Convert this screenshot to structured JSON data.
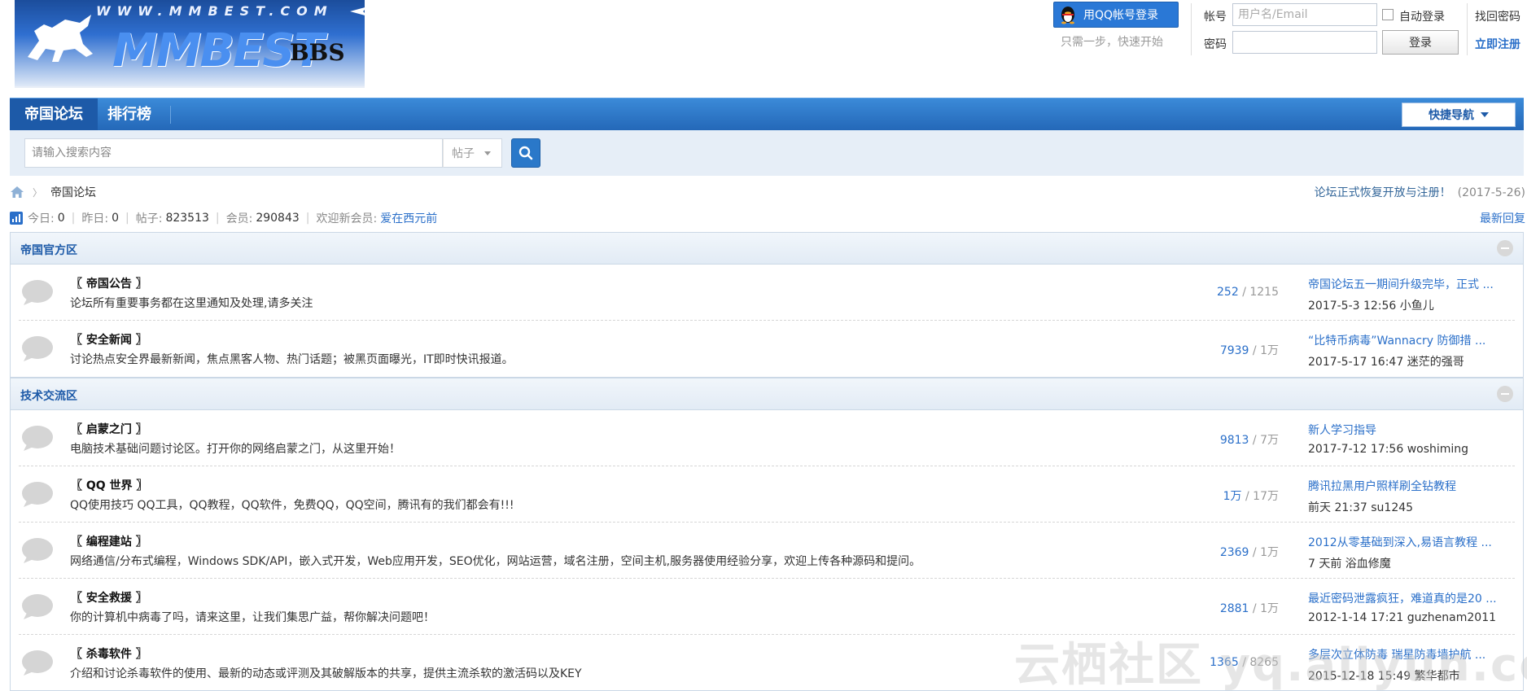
{
  "header": {
    "logo_url_text": "WWW.MMBEST.COM",
    "logo_brand": "MMBEST",
    "logo_bbs": "BBS",
    "qq_login_label": "用QQ帐号登录",
    "qq_note": "只需一步，快速开始",
    "account_label": "帐号",
    "account_placeholder": "用户名/Email",
    "password_label": "密码",
    "auto_login_label": "自动登录",
    "login_button": "登录",
    "find_password": "找回密码",
    "register": "立即注册"
  },
  "nav": {
    "items": [
      {
        "label": "帝国论坛",
        "active": true
      },
      {
        "label": "排行榜",
        "active": false
      }
    ],
    "quick_nav": "快捷导航"
  },
  "search": {
    "placeholder": "请输入搜索内容",
    "type": "帖子"
  },
  "breadcrumb": {
    "current": "帝国论坛"
  },
  "notice": {
    "text": "论坛正式恢复开放与注册！",
    "date": "(2017-5-26)"
  },
  "stats": {
    "today_label": "今日:",
    "today": "0",
    "yesterday_label": "昨日:",
    "yesterday": "0",
    "posts_label": "帖子:",
    "posts": "823513",
    "members_label": "会员:",
    "members": "290843",
    "welcome_label": "欢迎新会员:",
    "new_member": "爱在西元前",
    "latest_reply": "最新回复"
  },
  "sections": [
    {
      "title": "帝国官方区",
      "forums": [
        {
          "name": "〖 帝国公告 〗",
          "desc": "论坛所有重要事务都在这里通知及处理,请多关注",
          "threads": "252",
          "posts": "1215",
          "last_title": "帝国论坛五一期间升级完毕，正式 ...",
          "last_meta": "2017-5-3 12:56 小鱼儿"
        },
        {
          "name": "〖 安全新闻 〗",
          "desc": "讨论热点安全界最新新闻，焦点黑客人物、热门话题；被黑页面曝光，IT即时快讯报道。",
          "threads": "7939",
          "posts": "1万",
          "last_title": "“比特币病毒”Wannacry 防御措 ...",
          "last_meta": "2017-5-17 16:47 迷茫的强哥"
        }
      ]
    },
    {
      "title": "技术交流区",
      "forums": [
        {
          "name": "〖 启蒙之门 〗",
          "desc": "电脑技术基础问题讨论区。打开你的网络启蒙之门，从这里开始！",
          "threads": "9813",
          "posts": "7万",
          "last_title": "新人学习指导",
          "last_meta": "2017-7-12 17:56 woshiming"
        },
        {
          "name": "〖 QQ 世界 〗",
          "desc": "QQ使用技巧 QQ工具，QQ教程，QQ软件，免费QQ，QQ空间，腾讯有的我们都会有!!!",
          "threads": "1万",
          "posts": "17万",
          "last_title": "腾讯拉黑用户照样刷全钻教程",
          "last_meta": "前天 21:37 su1245"
        },
        {
          "name": "〖 编程建站 〗",
          "desc": "网络通信/分布式编程，Windows SDK/API，嵌入式开发，Web应用开发，SEO优化，网站运营，域名注册，空间主机,服务器使用经验分享，欢迎上传各种源码和提问。",
          "threads": "2369",
          "posts": "1万",
          "last_title": "2012从零基础到深入,易语言教程 ...",
          "last_meta": "7 天前 浴血修魔"
        },
        {
          "name": "〖 安全救援 〗",
          "desc": "你的计算机中病毒了吗，请来这里，让我们集思广益，帮你解决问题吧！",
          "threads": "2881",
          "posts": "1万",
          "last_title": "最近密码泄露疯狂，难道真的是20 ...",
          "last_meta": "2012-1-14 17:21 guzhenam2011"
        },
        {
          "name": "〖 杀毒软件 〗",
          "desc": "介绍和讨论杀毒软件的使用、最新的动态或评测及其破解版本的共享，提供主流杀软的激活码以及KEY",
          "threads": "1365",
          "posts": "8265",
          "last_title": "多层次立体防毒 瑞星防毒墙护航 ...",
          "last_meta": "2015-12-18 15:49 繁华都市"
        }
      ]
    }
  ],
  "watermark": "云栖社区 yq.aliyun.com",
  "colors": {
    "accent": "#2a78d6",
    "nav": "#2468b8",
    "link": "#2a6fc9"
  }
}
